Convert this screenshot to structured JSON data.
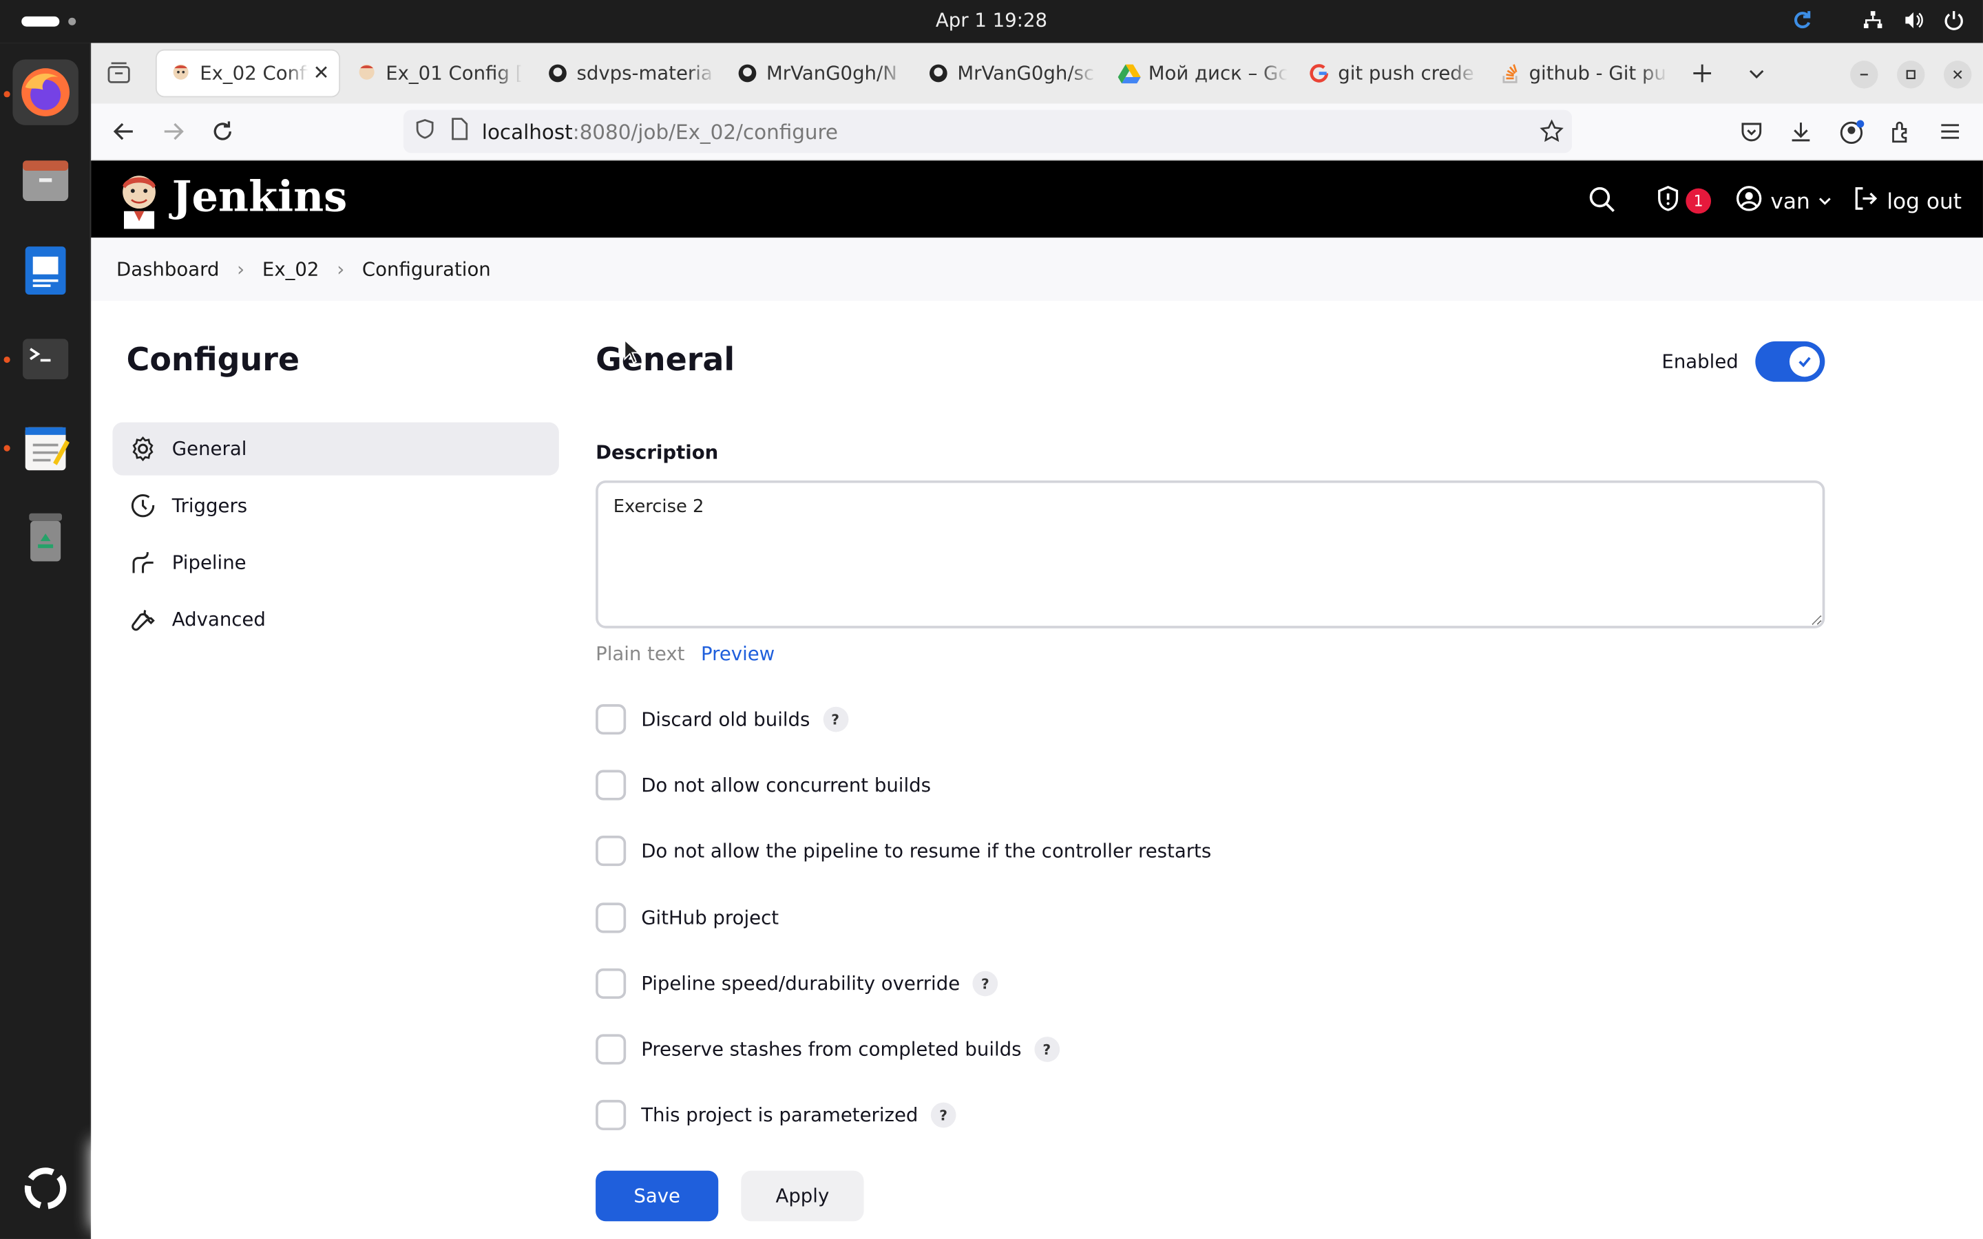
{
  "system": {
    "clock": "Apr 1  19:28"
  },
  "browser": {
    "tabs": [
      {
        "label": "Ex_02 Confi",
        "icon": "jenkins-icon"
      },
      {
        "label": "Ex_01 Config [",
        "icon": "jenkins-icon"
      },
      {
        "label": "sdvps-materia",
        "icon": "github-icon"
      },
      {
        "label": "MrVanG0gh/N",
        "icon": "github-icon"
      },
      {
        "label": "MrVanG0gh/sc",
        "icon": "github-icon"
      },
      {
        "label": "Мой диск – Gc",
        "icon": "google-drive-icon"
      },
      {
        "label": "git push crede",
        "icon": "google-icon"
      },
      {
        "label": "github - Git pu",
        "icon": "stackoverflow-icon"
      }
    ],
    "url_host": "localhost",
    "url_path": ":8080/job/Ex_02/configure"
  },
  "jenkins": {
    "title": "Jenkins",
    "security_count": "1",
    "user": "van",
    "logout": "log out"
  },
  "breadcrumb": {
    "items": [
      "Dashboard",
      "Ex_02",
      "Configuration"
    ]
  },
  "sidebar": {
    "title": "Configure",
    "items": [
      {
        "label": "General",
        "icon": "gear-icon"
      },
      {
        "label": "Triggers",
        "icon": "clock-icon"
      },
      {
        "label": "Pipeline",
        "icon": "pipeline-icon"
      },
      {
        "label": "Advanced",
        "icon": "wrench-icon"
      }
    ]
  },
  "general": {
    "title": "General",
    "enabled_label": "Enabled",
    "enabled": true,
    "description_label": "Description",
    "description_value": "Exercise 2",
    "format_plain": "Plain text",
    "format_preview": "Preview",
    "options": [
      {
        "label": "Discard old builds",
        "help": "?",
        "checked": false
      },
      {
        "label": "Do not allow concurrent builds",
        "checked": false
      },
      {
        "label": "Do not allow the pipeline to resume if the controller restarts",
        "checked": false
      },
      {
        "label": "GitHub project",
        "checked": false
      },
      {
        "label": "Pipeline speed/durability override",
        "help": "?",
        "checked": false
      },
      {
        "label": "Preserve stashes from completed builds",
        "help": "?",
        "checked": false
      },
      {
        "label": "This project is parameterized",
        "help": "?",
        "checked": false
      }
    ]
  },
  "actions": {
    "save": "Save",
    "apply": "Apply"
  },
  "colors": {
    "accent": "#1f5fdc",
    "header": "#000000",
    "badge": "#e6193c"
  }
}
